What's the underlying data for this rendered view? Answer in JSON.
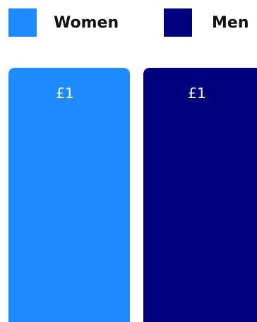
{
  "chart_data": {
    "type": "bar",
    "series": [
      {
        "name": "Women",
        "values": [
          1
        ],
        "value_label": "£1",
        "color": "#1E8CFF"
      },
      {
        "name": "Men",
        "values": [
          1
        ],
        "value_label": "£1",
        "color": "#00007F"
      }
    ],
    "ylim": [
      0,
      1
    ],
    "grid": false,
    "legend": "top"
  }
}
